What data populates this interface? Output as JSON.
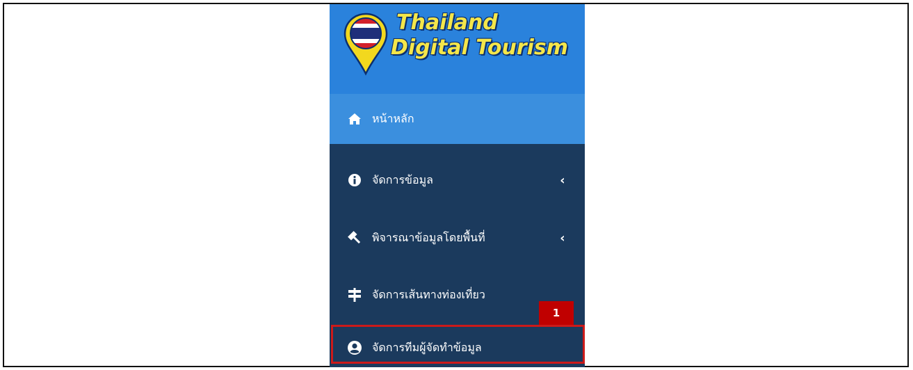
{
  "logo": {
    "line1": "Thailand",
    "line2": "Digital Tourism"
  },
  "menu": {
    "items": [
      {
        "label": "หน้าหลัก",
        "icon": "home-icon"
      },
      {
        "label": "จัดการข้อมูล",
        "icon": "info-circle-icon",
        "chevron": "‹"
      },
      {
        "label": "พิจารณาข้อมูลโดยพื้นที่",
        "icon": "gavel-icon",
        "chevron": "‹"
      },
      {
        "label": "จัดการเส้นทางท่องเที่ยว",
        "icon": "signpost-icon"
      },
      {
        "label": "จัดการทีมผู้จัดทำข้อมูล",
        "icon": "user-circle-icon"
      }
    ]
  },
  "annotation": {
    "badge": "1"
  },
  "colors": {
    "sidebar_bg": "#1b3a5d",
    "header_bg": "#2a82dc",
    "active_bg": "#3b8fde",
    "highlight": "#cc1a1a",
    "logo_text": "#f4e64a"
  }
}
